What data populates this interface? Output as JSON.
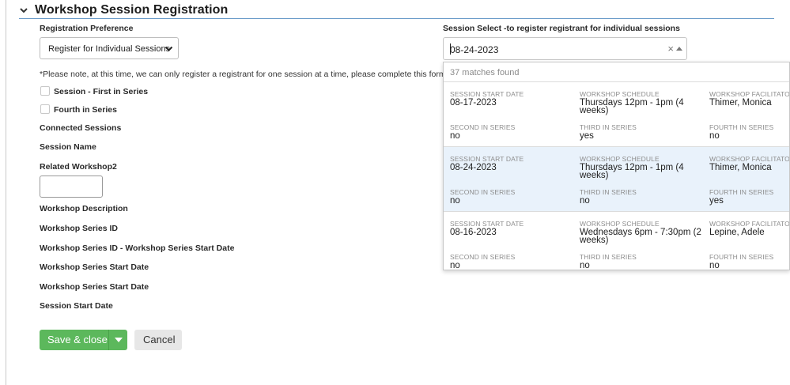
{
  "section": {
    "title": "Workshop Session Registration"
  },
  "form": {
    "registration_preference_label": "Registration Preference",
    "registration_preference_value": "Register for Individual Sessions",
    "note": "*Please note, at this time, we can only register a registrant for one session at a time, please complete this form fo",
    "checkboxes": [
      {
        "label": "Session - First in Series",
        "checked": false
      },
      {
        "label": "Fourth in Series",
        "checked": false
      }
    ],
    "fields": {
      "connected_sessions": "Connected Sessions",
      "session_name": "Session Name",
      "related_workshop": "Related Workshop2",
      "workshop_description": "Workshop Description",
      "workshop_series_id": "Workshop Series ID",
      "workshop_series_id_start_date": "Workshop Series ID - Workshop Series Start Date",
      "workshop_series_start_date_1": "Workshop Series Start Date",
      "workshop_series_start_date_2": "Workshop Series Start Date",
      "session_start_date": "Session Start Date"
    }
  },
  "session_select": {
    "label": "Session Select -to register registrant for individual sessions",
    "value": "08-24-2023",
    "clear_symbol": "×",
    "matches_text": "37 matches found",
    "headers": {
      "start_date": "SESSION START DATE",
      "schedule": "WORKSHOP SCHEDULE",
      "facilitator": "WORKSHOP FACILITATOR",
      "second": "SECOND IN SERIES",
      "third": "THIRD IN SERIES",
      "fourth": "FOURTH IN SERIES"
    },
    "options": [
      {
        "start_date": "08-17-2023",
        "schedule": "Thursdays 12pm - 1pm (4 weeks)",
        "facilitator": "Thimer, Monica",
        "second": "no",
        "third": "yes",
        "fourth": "no",
        "highlighted": false
      },
      {
        "start_date": "08-24-2023",
        "schedule": "Thursdays 12pm - 1pm (4 weeks)",
        "facilitator": "Thimer, Monica",
        "second": "no",
        "third": "no",
        "fourth": "yes",
        "highlighted": true
      },
      {
        "start_date": "08-16-2023",
        "schedule": "Wednesdays 6pm - 7:30pm (2 weeks)",
        "facilitator": "Lepine, Adele",
        "second": "no",
        "third": "no",
        "fourth": "no",
        "highlighted": false
      }
    ]
  },
  "buttons": {
    "save_close": "Save & close",
    "cancel": "Cancel"
  },
  "colors": {
    "primary_green": "#5cb85c",
    "header_rule": "#6a9bc9",
    "highlight_row": "#e9f2fb"
  }
}
